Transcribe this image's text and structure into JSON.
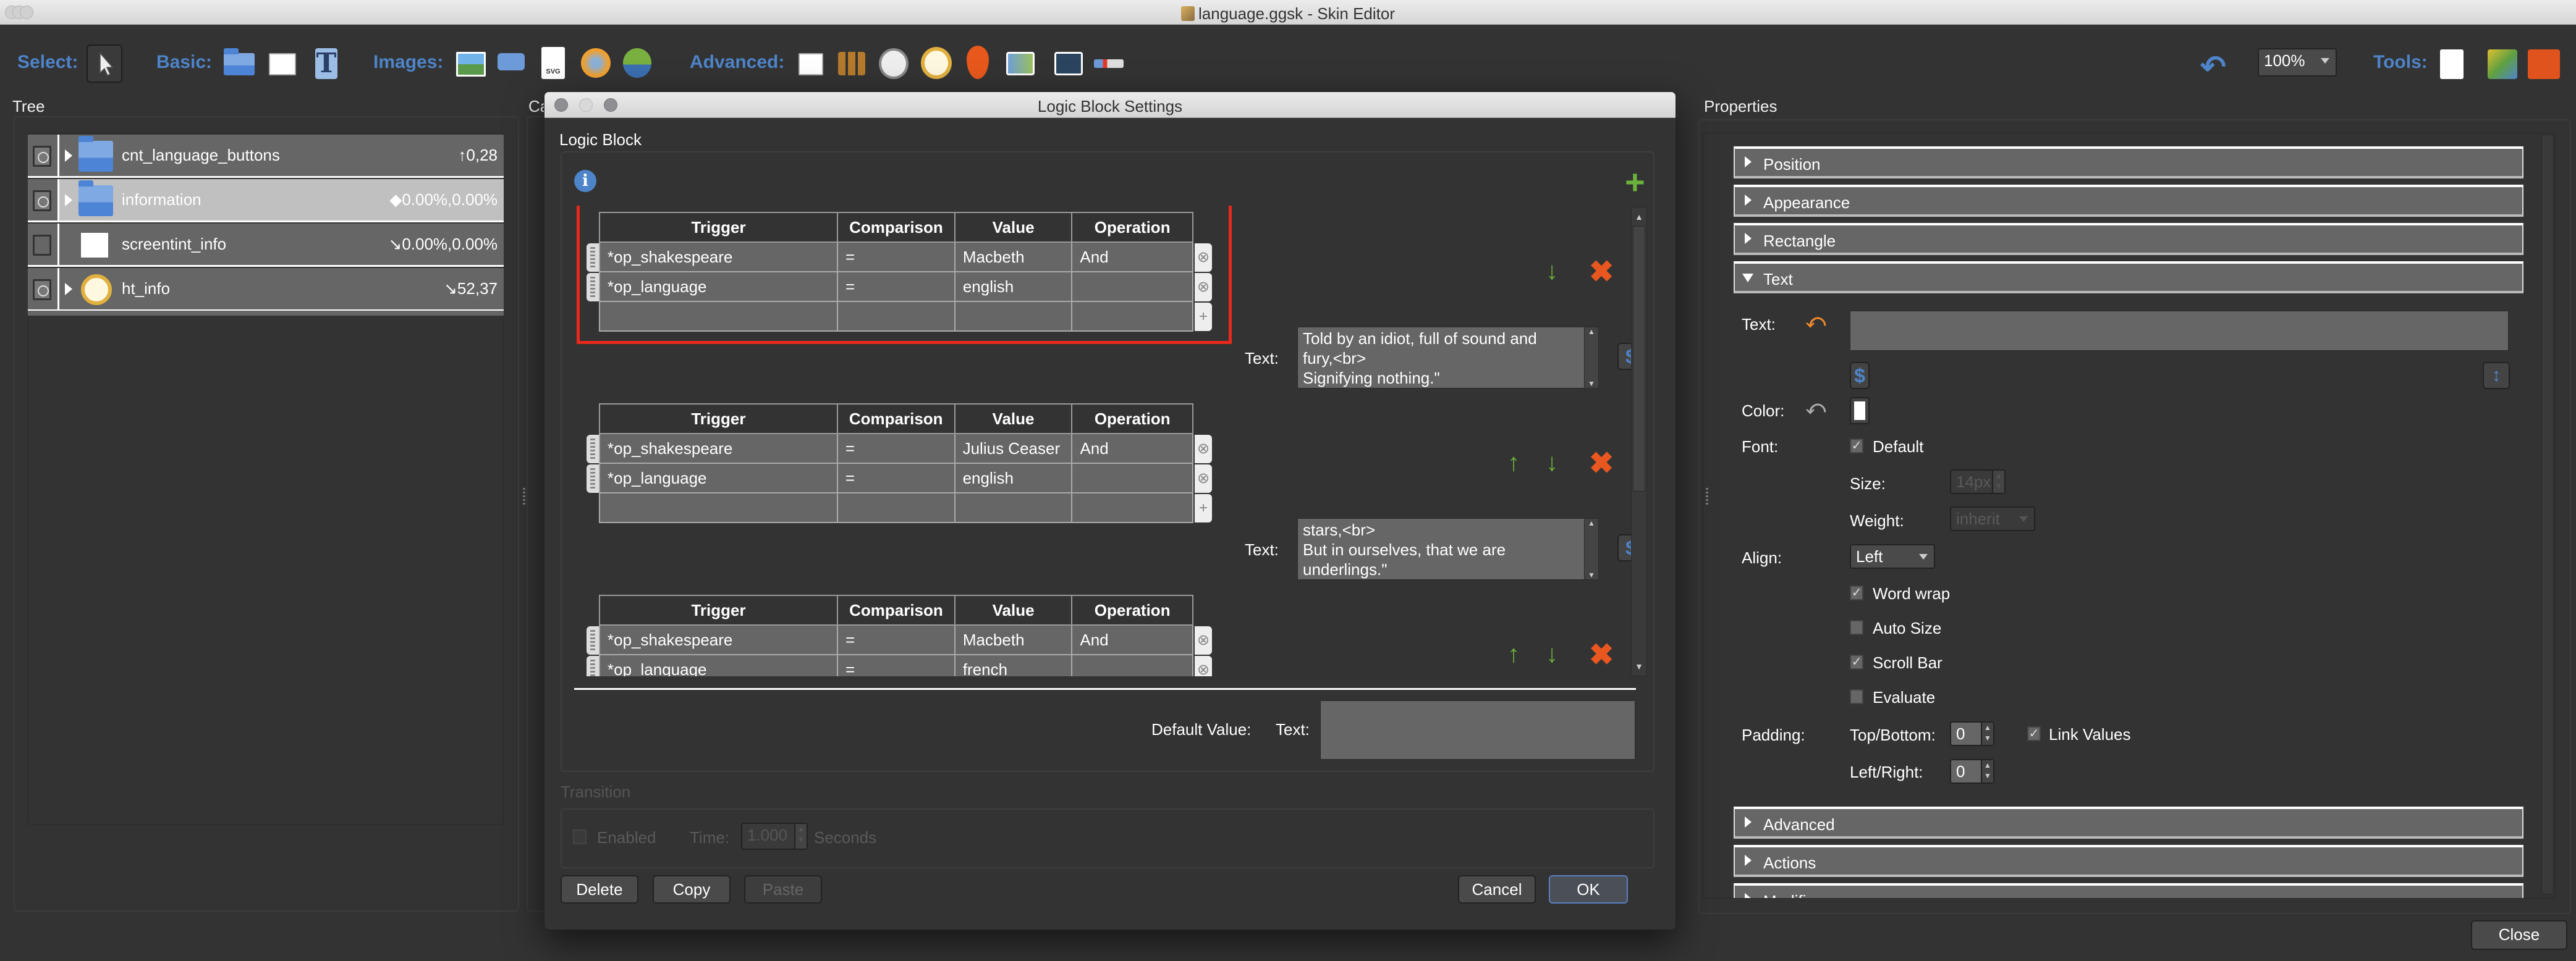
{
  "window": {
    "title": "language.ggsk - Skin Editor"
  },
  "toolbar": {
    "select_label": "Select:",
    "basic_label": "Basic:",
    "images_label": "Images:",
    "advanced_label": "Advanced:",
    "tools_label": "Tools:",
    "zoom_value": "100%",
    "select_tools": [
      "pointer-icon"
    ],
    "basic_tools": [
      "container-folder-icon",
      "rectangle-icon",
      "text-icon"
    ],
    "image_tools": [
      "image-icon",
      "button-icon",
      "svg-icon",
      "hotspot-globe-icon",
      "map-pin-globe-icon"
    ],
    "advanced_tools": [
      "scrollarea-icon",
      "cloner-icon",
      "timer-icon",
      "hotspot-crosshair-icon",
      "map-pin-icon",
      "map-icon",
      "video-icon",
      "toggle-icon"
    ],
    "tools": [
      "find-icon",
      "color-palette-icon",
      "toolbox-icon"
    ]
  },
  "tree": {
    "title": "Tree",
    "rows": [
      {
        "name": "cnt_language_buttons",
        "pos": "↑0,28",
        "visible": true,
        "expandable": true,
        "icon": "folder",
        "selected": false
      },
      {
        "name": "information",
        "pos": "◆0.00%,0.00%",
        "visible": true,
        "expandable": true,
        "icon": "folder",
        "selected": true
      },
      {
        "name": "screentint_info",
        "pos": "↘0.00%,0.00%",
        "visible": false,
        "expandable": false,
        "icon": "rectangle",
        "selected": false
      },
      {
        "name": "ht_info",
        "pos": "↘52,37",
        "visible": true,
        "expandable": true,
        "icon": "hotspot",
        "selected": false
      }
    ]
  },
  "canvas": {
    "title_partial": "Ca"
  },
  "dialog": {
    "title": "Logic Block Settings",
    "section_label": "Logic Block",
    "columns": [
      "Trigger",
      "Comparison",
      "Value",
      "Operation"
    ],
    "blocks": [
      {
        "rows": [
          {
            "trigger": "*op_shakespeare",
            "comparison": "=",
            "value": "Macbeth",
            "operation": "And"
          },
          {
            "trigger": "*op_language",
            "comparison": "=",
            "value": "english",
            "operation": ""
          }
        ],
        "text_label": "Text:",
        "text_lines": [
          "Told by an idiot, full of sound and",
          "fury,<br>",
          "Signifying nothing.\""
        ],
        "highlighted": true
      },
      {
        "rows": [
          {
            "trigger": "*op_shakespeare",
            "comparison": "=",
            "value": "Julius Ceaser",
            "operation": "And"
          },
          {
            "trigger": "*op_language",
            "comparison": "=",
            "value": "english",
            "operation": ""
          }
        ],
        "text_label": "Text:",
        "text_lines": [
          "stars,<br>",
          "But in ourselves, that we are",
          "underlings.\""
        ],
        "highlighted": false
      },
      {
        "rows": [
          {
            "trigger": "*op_shakespeare",
            "comparison": "=",
            "value": "Macbeth",
            "operation": "And"
          },
          {
            "trigger": "*op_language",
            "comparison": "=",
            "value": "french",
            "operation": ""
          }
        ],
        "highlighted": false
      }
    ],
    "default_value_label": "Default Value:",
    "default_text_label": "Text:",
    "default_text_value": "",
    "transition": {
      "title": "Transition",
      "enabled_label": "Enabled",
      "enabled": false,
      "time_label": "Time:",
      "time_value": "1.000",
      "unit": "Seconds"
    },
    "buttons": {
      "delete": "Delete",
      "copy": "Copy",
      "paste": "Paste",
      "cancel": "Cancel",
      "ok": "OK"
    }
  },
  "properties": {
    "title": "Properties",
    "sections_top": [
      "Position",
      "Appearance",
      "Rectangle",
      "Text"
    ],
    "sections_bottom": [
      "Advanced",
      "Actions",
      "Modifiers"
    ],
    "text": {
      "text_label": "Text:",
      "text_value": "",
      "color_label": "Color:",
      "color_value": "#ffffff",
      "font_label": "Font:",
      "font_default_label": "Default",
      "font_default": true,
      "size_label": "Size:",
      "size_value": "14px",
      "weight_label": "Weight:",
      "weight_value": "inherit",
      "align_label": "Align:",
      "align_value": "Left",
      "word_wrap_label": "Word wrap",
      "word_wrap": true,
      "auto_size_label": "Auto Size",
      "auto_size": false,
      "scroll_bar_label": "Scroll Bar",
      "scroll_bar": true,
      "evaluate_label": "Evaluate",
      "evaluate": false,
      "padding_label": "Padding:",
      "top_bottom_label": "Top/Bottom:",
      "top_bottom_value": "0",
      "link_values_label": "Link Values",
      "link_values": true,
      "left_right_label": "Left/Right:",
      "left_right_value": "0"
    },
    "close_label": "Close"
  },
  "colors": {
    "accent": "#4e84c9",
    "highlight_border": "#e8291c",
    "add_green": "#6bb33c",
    "delete_orange": "#e8571f"
  }
}
